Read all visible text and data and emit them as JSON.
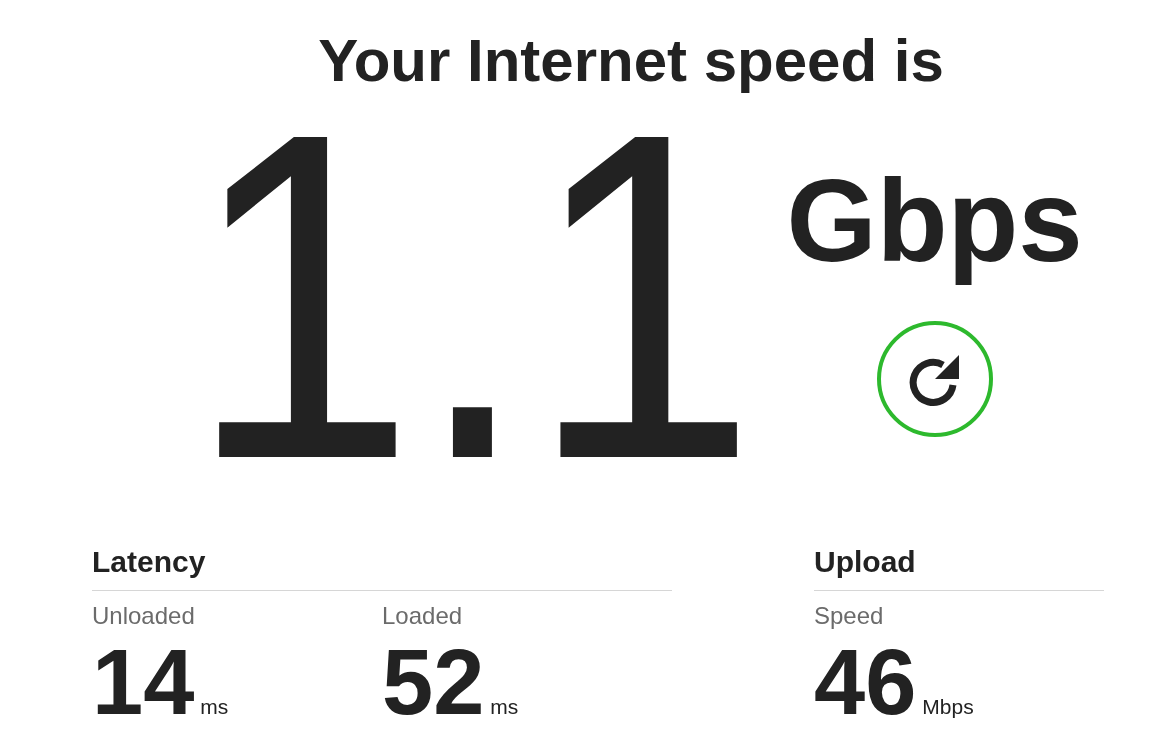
{
  "title": "Your Internet speed is",
  "speed": {
    "value": "1.1",
    "unit": "Gbps"
  },
  "sections": [
    {
      "title": "Latency",
      "metrics": [
        {
          "label": "Unloaded",
          "value": "14",
          "unit": "ms"
        },
        {
          "label": "Loaded",
          "value": "52",
          "unit": "ms"
        }
      ]
    },
    {
      "title": "Upload",
      "metrics": [
        {
          "label": "Speed",
          "value": "46",
          "unit": "Mbps"
        }
      ]
    }
  ]
}
